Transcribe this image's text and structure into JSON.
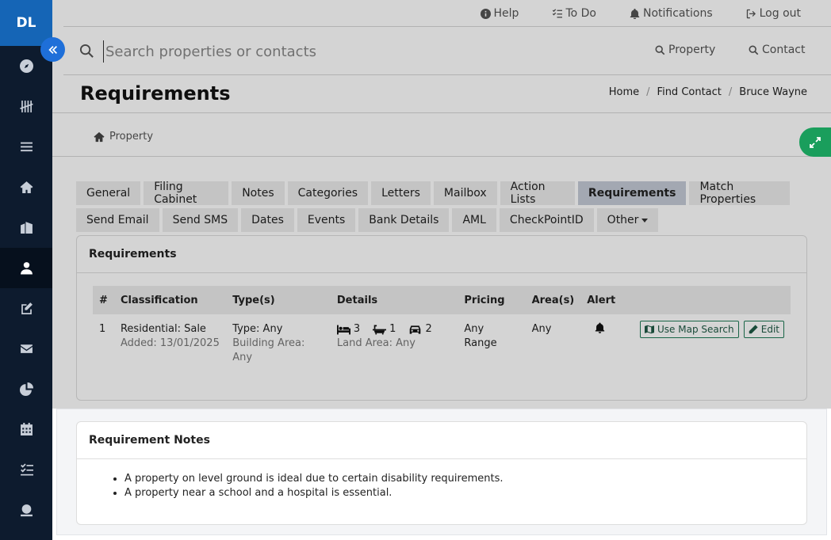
{
  "brand": {
    "initials": "DL"
  },
  "sidebar": {
    "items": [
      {
        "icon": "compass-icon"
      },
      {
        "icon": "tally-icon"
      },
      {
        "icon": "menu-icon"
      },
      {
        "icon": "home-icon"
      },
      {
        "icon": "building-icon"
      },
      {
        "icon": "user-icon",
        "active": true
      },
      {
        "icon": "edit-icon"
      },
      {
        "icon": "envelope-icon"
      },
      {
        "icon": "pie-chart-icon"
      },
      {
        "icon": "calendar-icon"
      },
      {
        "icon": "checklist-icon"
      },
      {
        "icon": "money-icon"
      }
    ]
  },
  "topbar": {
    "help": "Help",
    "todo": "To Do",
    "notifications": "Notifications",
    "logout": "Log out"
  },
  "search": {
    "placeholder": "Search properties or contacts",
    "property": "Property",
    "contact": "Contact"
  },
  "page": {
    "title": "Requirements",
    "breadcrumb": [
      "Home",
      "Find Contact",
      "Bruce Wayne"
    ]
  },
  "subnav": {
    "property": "Property"
  },
  "tabs": {
    "row1": [
      "General",
      "Filing Cabinet",
      "Notes",
      "Categories",
      "Letters",
      "Mailbox",
      "Action Lists",
      "Requirements",
      "Match Properties"
    ],
    "row2": [
      "Send Email",
      "Send SMS",
      "Dates",
      "Events",
      "Bank Details",
      "AML",
      "CheckPointID",
      "Other"
    ],
    "active": "Requirements"
  },
  "requirements": {
    "heading": "Requirements",
    "columns": [
      "#",
      "Classification",
      "Type(s)",
      "Details",
      "Pricing",
      "Area(s)",
      "Alert"
    ],
    "rows": [
      {
        "num": "1",
        "classification": "Residential: Sale",
        "added": "Added: 13/01/2025",
        "type": "Type: Any",
        "building_area": "Building Area: Any",
        "beds": "3",
        "baths": "1",
        "cars": "2",
        "land_area": "Land Area: Any",
        "pricing": "Any Range",
        "areas": "Any",
        "map_search": "Use Map Search",
        "edit": "Edit"
      }
    ]
  },
  "notes": {
    "heading": "Requirement Notes",
    "items": [
      "A property on level ground is ideal due to certain disability requirements.",
      "A property near a school and a hospital is essential."
    ]
  },
  "colors": {
    "sidebar": "#0d1b2e",
    "brand": "#1565b6",
    "accent_green": "#1a9e5c",
    "collapse_blue": "#1e6fd9"
  }
}
